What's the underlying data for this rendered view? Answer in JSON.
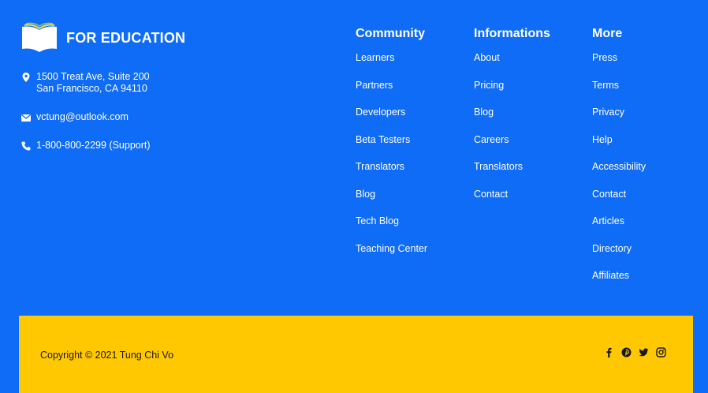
{
  "brand": {
    "name": "FOR EDUCATION",
    "logo_icon": "open-book-icon"
  },
  "contact": {
    "address_line1": "1500 Treat Ave, Suite 200",
    "address_line2": "San Francisco, CA 94110",
    "email": "vctung@outlook.com",
    "phone": "1-800-800-2299 (Support)"
  },
  "columns": [
    {
      "title": "Community",
      "links": [
        "Learners",
        "Partners",
        "Developers",
        "Beta Testers",
        "Translators",
        "Blog",
        "Tech Blog",
        "Teaching Center"
      ]
    },
    {
      "title": "Informations",
      "links": [
        "About",
        "Pricing",
        "Blog",
        "Careers",
        "Translators",
        "Contact"
      ]
    },
    {
      "title": "More",
      "links": [
        "Press",
        "Terms",
        "Privacy",
        "Help",
        "Accessibility",
        "Contact",
        "Articles",
        "Directory",
        "Affiliates"
      ]
    }
  ],
  "footer": {
    "copyright": "Copyright © 2021 Tung Chi Vo",
    "social_icons": [
      "facebook-icon",
      "pinterest-icon",
      "twitter-icon",
      "instagram-icon"
    ]
  },
  "colors": {
    "background": "#0f6cf7",
    "bottom_bar": "#ffc800",
    "text": "#ffffff"
  }
}
